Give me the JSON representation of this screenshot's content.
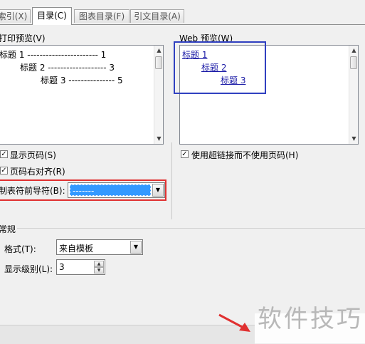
{
  "tabs": [
    {
      "label": "索引(X)"
    },
    {
      "label": "目录(C)",
      "active": true
    },
    {
      "label": "图表目录(F)"
    },
    {
      "label": "引文目录(A)"
    }
  ],
  "print_preview": {
    "label": "打印预览(V)",
    "entries": [
      {
        "text": "标题 1 ----------------------- 1"
      },
      {
        "text": "标题 2 ------------------- 3"
      },
      {
        "text": "标题 3 --------------- 5"
      }
    ]
  },
  "web_preview": {
    "label": "Web 预览(W)",
    "entries": [
      {
        "text": "标题 1"
      },
      {
        "text": "标题 2"
      },
      {
        "text": "标题 3"
      }
    ]
  },
  "options": {
    "show_page_numbers": "显示页码(S)",
    "right_align": "页码右对齐(R)",
    "use_hyperlinks": "使用超链接而不使用页码(H)",
    "tab_leader_label": "制表符前导符(B):",
    "tab_leader_value": "-------"
  },
  "general": {
    "title": "常规",
    "format_label": "格式(T):",
    "format_value": "来自模板",
    "levels_label": "显示级别(L):",
    "levels_value": "3"
  },
  "watermark": "软件技巧",
  "colors": {
    "highlight_red": "#e03030",
    "highlight_blue": "#3040c0",
    "selection": "#3399ff"
  }
}
